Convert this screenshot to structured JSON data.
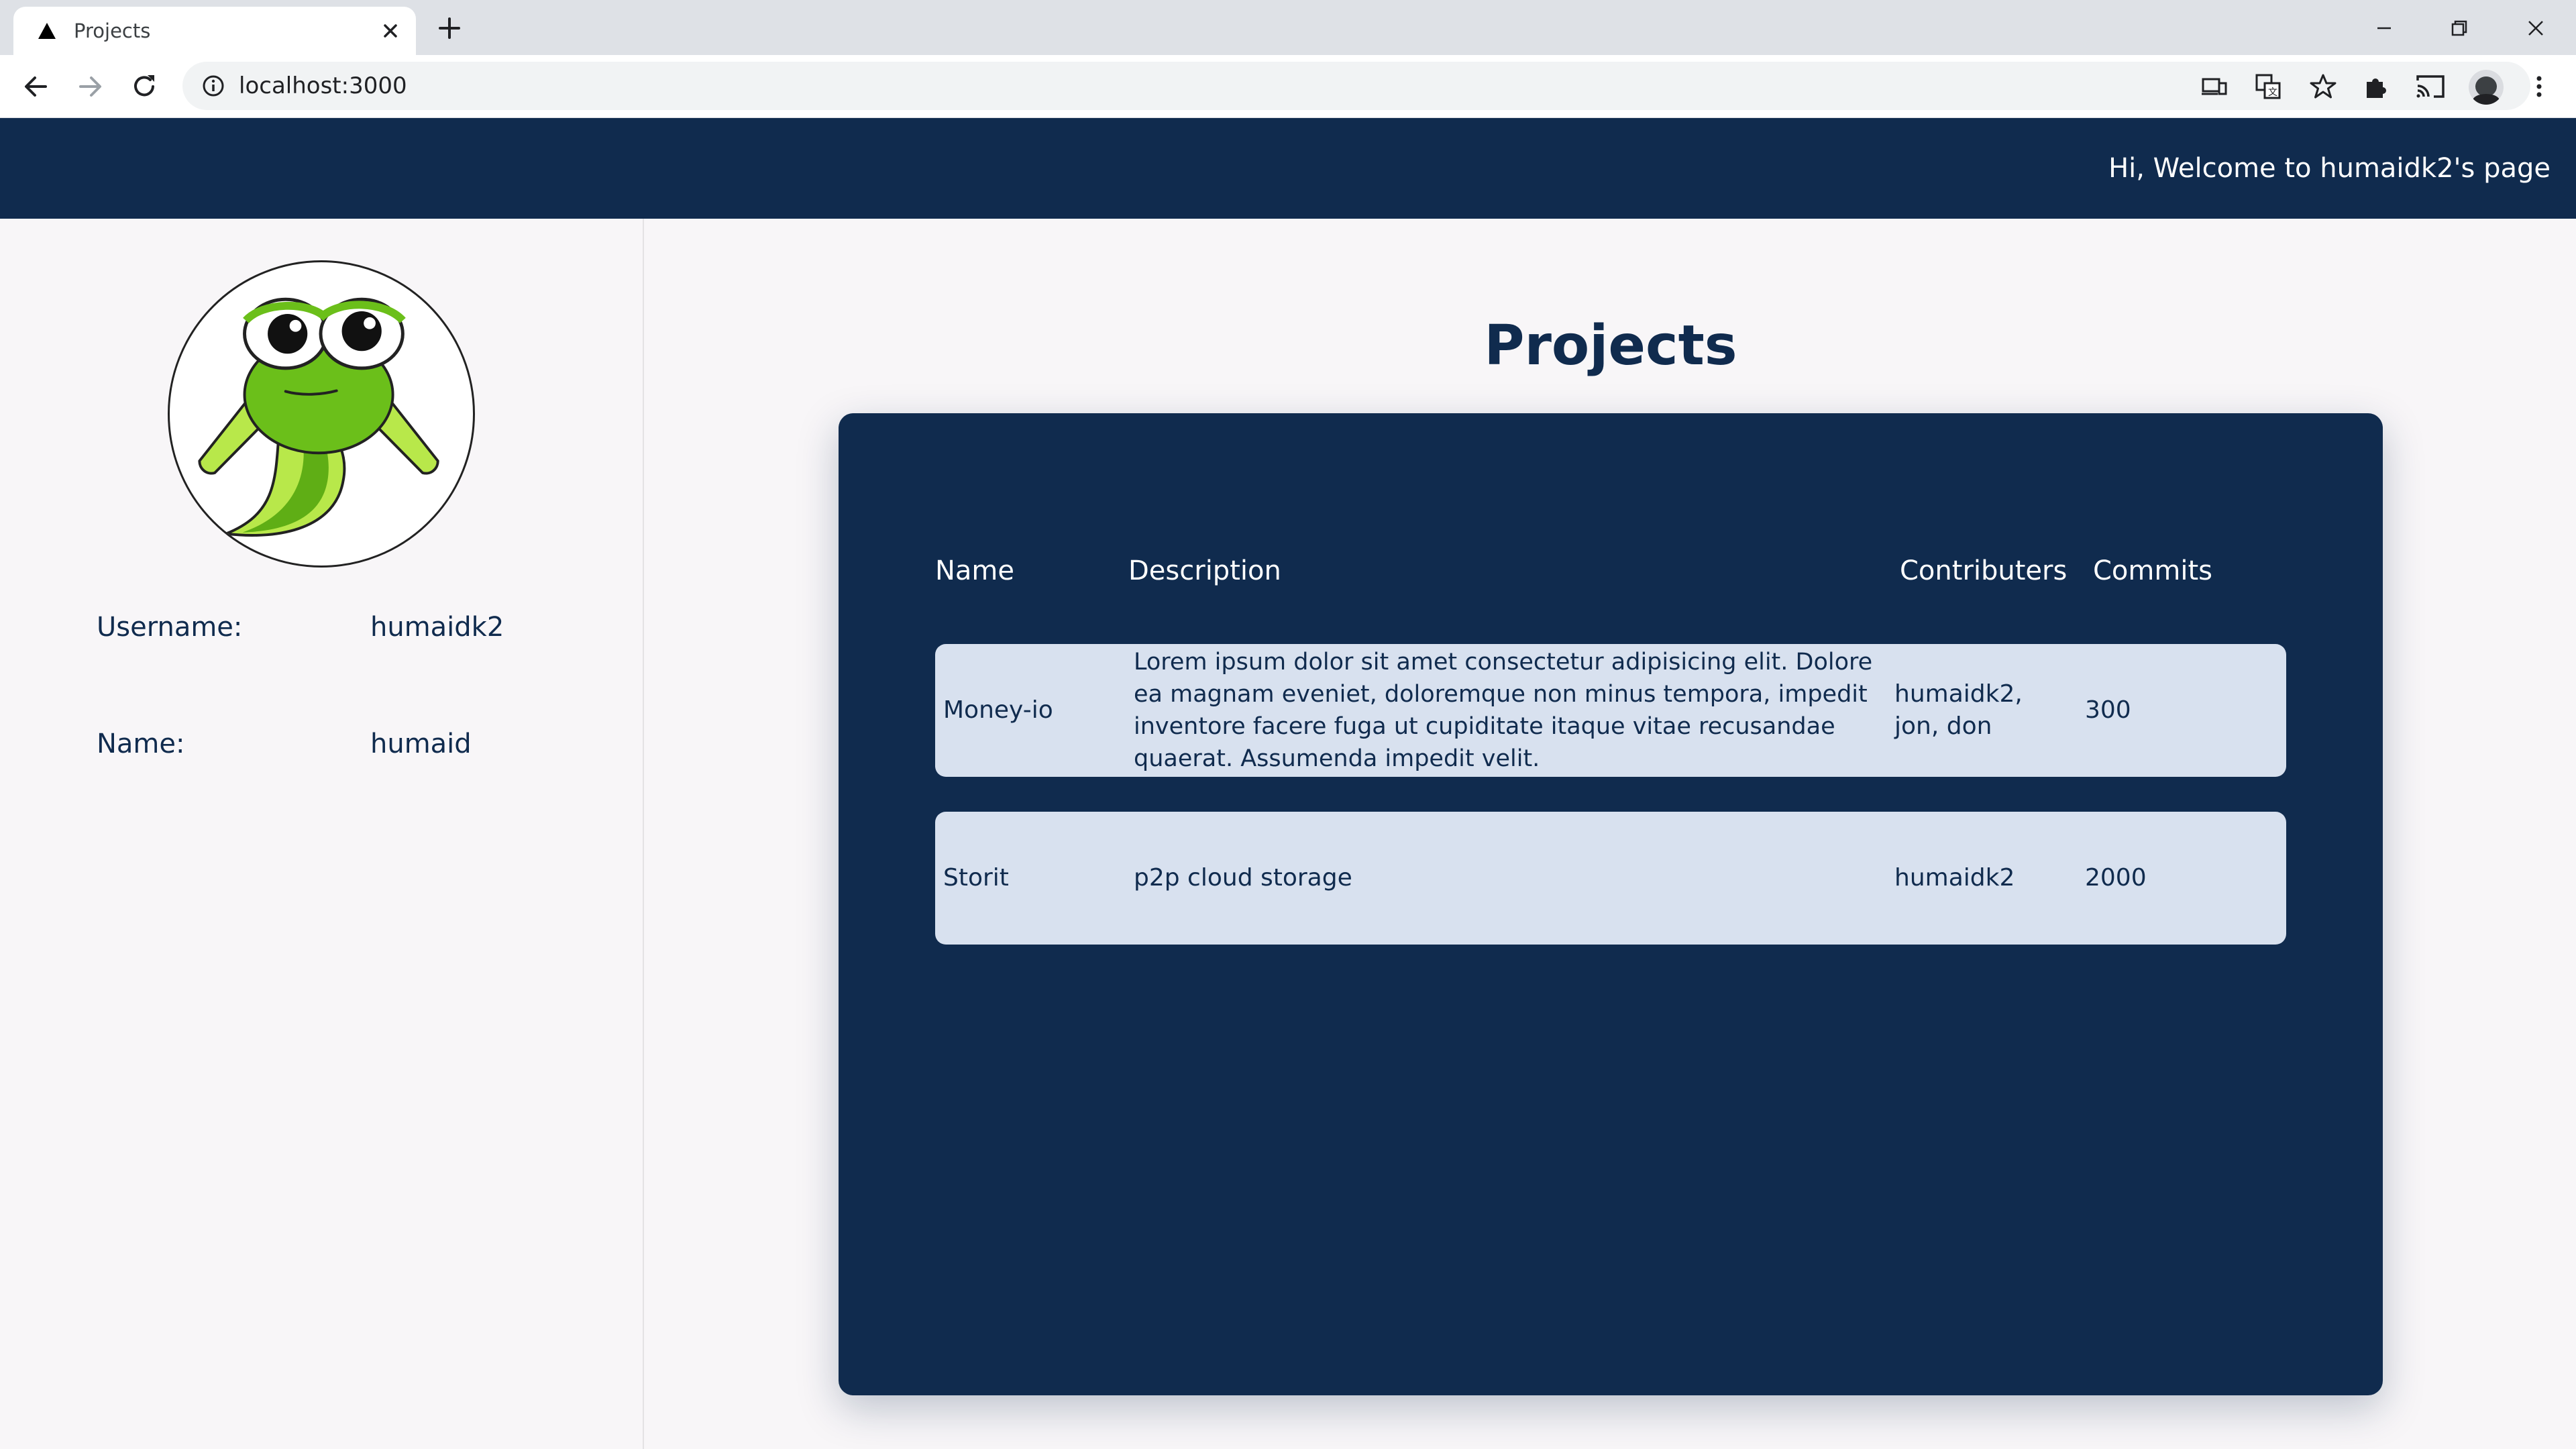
{
  "browser": {
    "tab_title": "Projects",
    "url": "localhost:3000"
  },
  "header": {
    "welcome": "Hi, Welcome to humaidk2's page"
  },
  "profile": {
    "username_label": "Username:",
    "username_value": "humaidk2",
    "name_label": "Name:",
    "name_value": "humaid"
  },
  "projects": {
    "title": "Projects",
    "columns": {
      "name": "Name",
      "description": "Description",
      "contributers": "Contributers",
      "commits": "Commits"
    },
    "rows": [
      {
        "name": "Money-io",
        "description": "Lorem ipsum dolor sit amet consectetur adipisicing elit. Dolore ea magnam eveniet, doloremque non minus tempora, impedit inventore facere fuga ut cupiditate itaque vitae recusandae quaerat. Assumenda impedit velit.",
        "contributers": "humaidk2, jon, don",
        "commits": "300"
      },
      {
        "name": "Storit",
        "description": "p2p cloud storage",
        "contributers": "humaidk2",
        "commits": "2000"
      }
    ]
  },
  "colors": {
    "navy": "#102b4e",
    "row_bg": "#d8e1ef",
    "page_bg": "#f8f6f8"
  }
}
